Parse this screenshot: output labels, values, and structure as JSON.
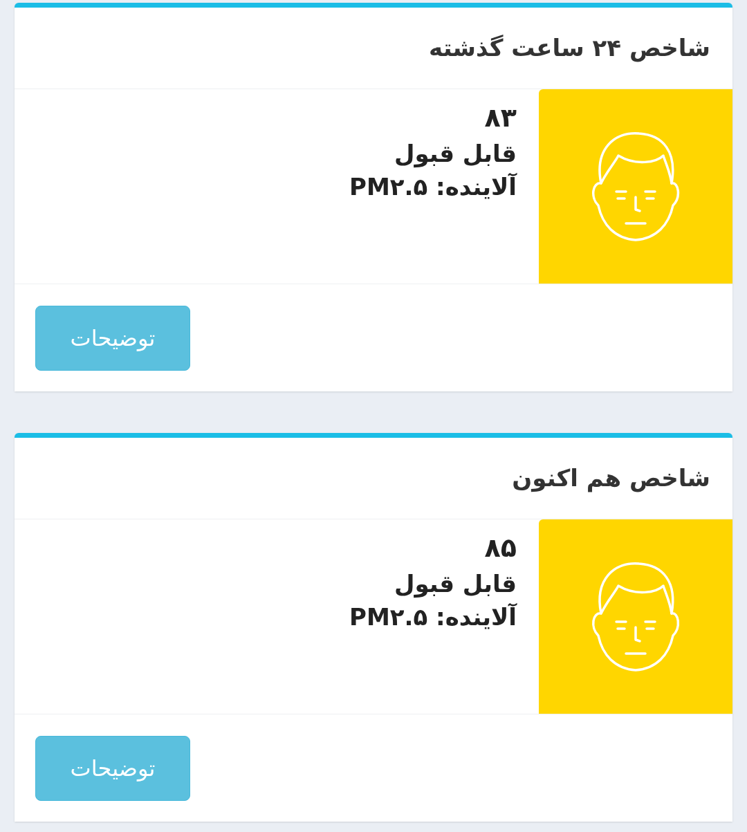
{
  "cards": [
    {
      "title": "شاخص ۲۴ ساعت گذشته",
      "value": "۸۳",
      "status": "قابل قبول",
      "pollutant": "آلاینده: PM۲.۵",
      "color": "#ffd600",
      "button": "توضیحات"
    },
    {
      "title": "شاخص هم اکنون",
      "value": "۸۵",
      "status": "قابل قبول",
      "pollutant": "آلاینده: PM۲.۵",
      "color": "#ffd600",
      "button": "توضیحات"
    }
  ]
}
